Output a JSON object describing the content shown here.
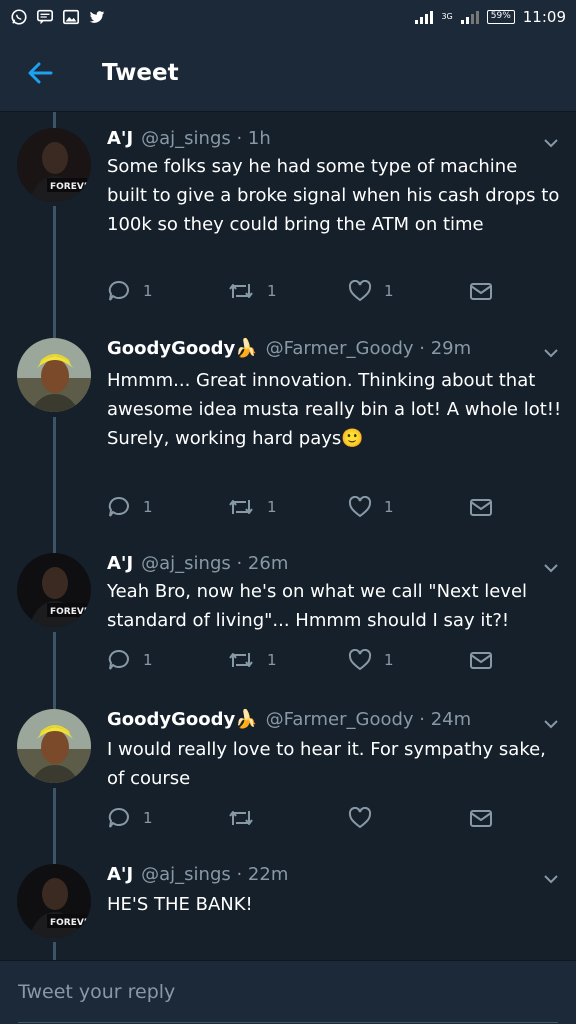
{
  "status_bar": {
    "network": "3G",
    "battery": "59%",
    "time": "11:09",
    "notification_icons": [
      "whatsapp-icon",
      "message-icon",
      "gallery-icon",
      "twitter-icon"
    ]
  },
  "header": {
    "title": "Tweet",
    "back_icon": "arrow-left-icon"
  },
  "tweets": [
    {
      "name": "A'J",
      "handle": "@aj_sings · 1h",
      "text": "Some folks say he had some type of machine built to give a broke signal when his cash drops to 100k so they could bring the ATM on time",
      "replies": "1",
      "retweets": "1",
      "likes": "1",
      "avatar_label": "FOREVE"
    },
    {
      "name": "GoodyGoody🍌",
      "handle": "@Farmer_Goody · 29m",
      "text": "Hmmm... Great innovation. Thinking about that awesome idea musta really bin a lot! A whole lot!!\nSurely, working hard pays🙂",
      "replies": "1",
      "retweets": "1",
      "likes": "1"
    },
    {
      "name": "A'J",
      "handle": "@aj_sings · 26m",
      "text": "Yeah Bro, now he's on what we call \"Next level standard of living\"... Hmmm should I say it?!",
      "replies": "1",
      "retweets": "1",
      "likes": "1",
      "avatar_label": "FOREVE"
    },
    {
      "name": "GoodyGoody🍌",
      "handle": "@Farmer_Goody · 24m",
      "text": "I would really love to hear it. For sympathy sake, of course",
      "replies": "1",
      "retweets": "",
      "likes": ""
    },
    {
      "name": "A'J",
      "handle": "@aj_sings · 22m",
      "text": "HE'S THE BANK!",
      "avatar_label": "FOREVE"
    }
  ],
  "reply": {
    "placeholder": "Tweet your reply"
  },
  "colors": {
    "background": "#15202b",
    "bar": "#1c2938",
    "accent": "#1da1f2",
    "muted": "#8899a6",
    "thread_line": "#3d5466"
  }
}
